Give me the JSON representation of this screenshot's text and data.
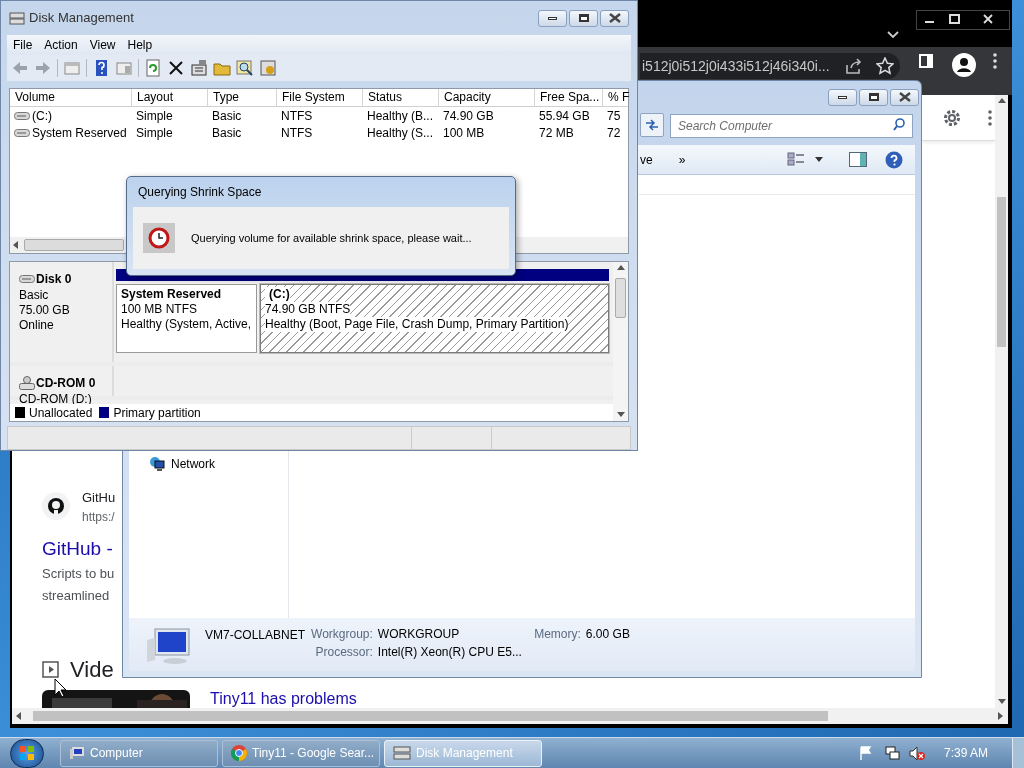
{
  "disk_management": {
    "title": "Disk Management",
    "menu": [
      "File",
      "Action",
      "View",
      "Help"
    ],
    "volume_table": {
      "columns": [
        "Volume",
        "Layout",
        "Type",
        "File System",
        "Status",
        "Capacity",
        "Free Spa...",
        "% F"
      ],
      "rows": [
        {
          "cells": [
            "(C:)",
            "Simple",
            "Basic",
            "NTFS",
            "Healthy (B...",
            "74.90 GB",
            "55.94 GB",
            "75"
          ]
        },
        {
          "cells": [
            "System Reserved",
            "Simple",
            "Basic",
            "NTFS",
            "Healthy (S...",
            "100 MB",
            "72 MB",
            "72"
          ]
        }
      ]
    },
    "disks": [
      {
        "kind": "disk",
        "name": "Disk 0",
        "details": [
          "Basic",
          "75.00 GB",
          "Online"
        ],
        "partitions": [
          {
            "name": "System Reserved",
            "details": [
              "100 MB NTFS",
              "Healthy (System, Active,"
            ],
            "selected": false
          },
          {
            "name": "(C:)",
            "details": [
              "74.90 GB NTFS",
              "Healthy (Boot, Page File, Crash Dump, Primary Partition)"
            ],
            "selected": true
          }
        ]
      },
      {
        "kind": "cdrom",
        "name": "CD-ROM 0",
        "details": [
          "CD-ROM (D:)"
        ]
      }
    ],
    "legend": [
      {
        "label": "Unallocated",
        "color": "#000000"
      },
      {
        "label": "Primary partition",
        "color": "#000080"
      }
    ]
  },
  "dialog": {
    "title": "Querying Shrink Space",
    "message": "Querying volume for available shrink space, please wait..."
  },
  "explorer": {
    "search": {
      "placeholder": "Search Computer"
    },
    "toolbar": [
      "ve",
      "»"
    ],
    "nav_items": [
      "Network"
    ],
    "details": {
      "name": "VM7-COLLABNET",
      "fields": [
        {
          "label": "Workgroup:",
          "value": "WORKGROUP"
        },
        {
          "label": "Memory:",
          "value": "6.00 GB"
        },
        {
          "label": "Processor:",
          "value": "Intel(R) Xeon(R) CPU E5..."
        }
      ]
    }
  },
  "browser": {
    "address": "i512j0i512j0i433i512j46i340i...",
    "result": {
      "site": "GitHu",
      "url": "https:/",
      "title": "GitHub - ",
      "snippet": [
        "Scripts to bu",
        "streamlined"
      ]
    },
    "videos_heading": "Vide",
    "video_title": "Tiny11 has problems"
  },
  "taskbar": {
    "buttons": [
      {
        "kind": "computer",
        "label": "Computer",
        "selected": false
      },
      {
        "kind": "browser",
        "label": "Tiny11 - Google Sear...",
        "selected": false
      },
      {
        "kind": "disk",
        "label": "Disk Management",
        "selected": true
      }
    ],
    "clock": "7:39 AM"
  }
}
